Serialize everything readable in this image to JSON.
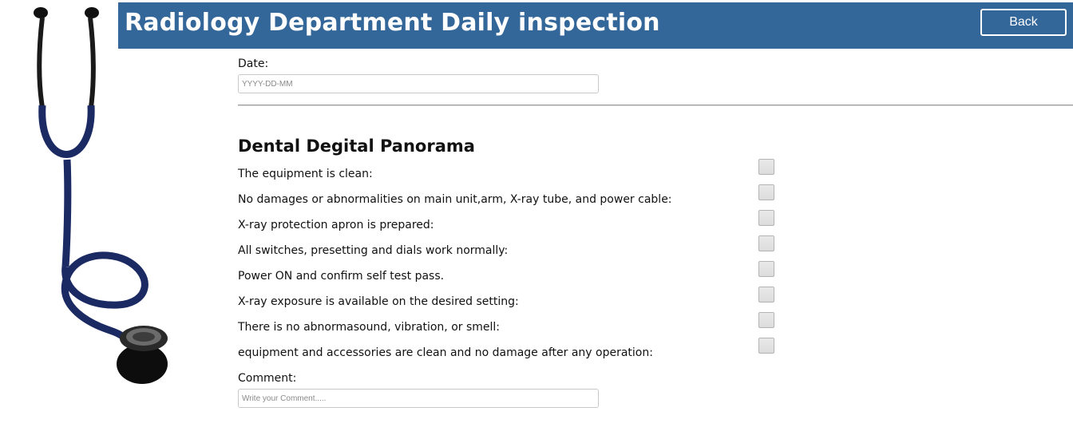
{
  "header": {
    "title": "Radiology Department Daily inspection",
    "back_label": "Back",
    "background_color": "#336699"
  },
  "decor": {
    "image": "stethoscope-image"
  },
  "date": {
    "label": "Date:",
    "placeholder": "YYYY-DD-MM",
    "value": ""
  },
  "section": {
    "title": "Dental Degital Panorama",
    "items": [
      {
        "label": "The equipment is clean:",
        "checked": false
      },
      {
        "label": "No damages or abnormalities on main unit,arm, X-ray tube, and power cable:",
        "checked": false
      },
      {
        "label": "X-ray protection apron is prepared:",
        "checked": false
      },
      {
        "label": "All switches, presetting and dials work normally:",
        "checked": false
      },
      {
        "label": "Power ON and confirm self test pass.",
        "checked": false
      },
      {
        "label": "X-ray exposure is available on the desired setting:",
        "checked": false
      },
      {
        "label": "There is no abnormasound, vibration, or smell:",
        "checked": false
      },
      {
        "label": "equipment and accessories are clean and no damage after any operation:",
        "checked": false
      }
    ]
  },
  "comment": {
    "label": "Comment:",
    "placeholder": "Write your Comment.....",
    "value": ""
  }
}
